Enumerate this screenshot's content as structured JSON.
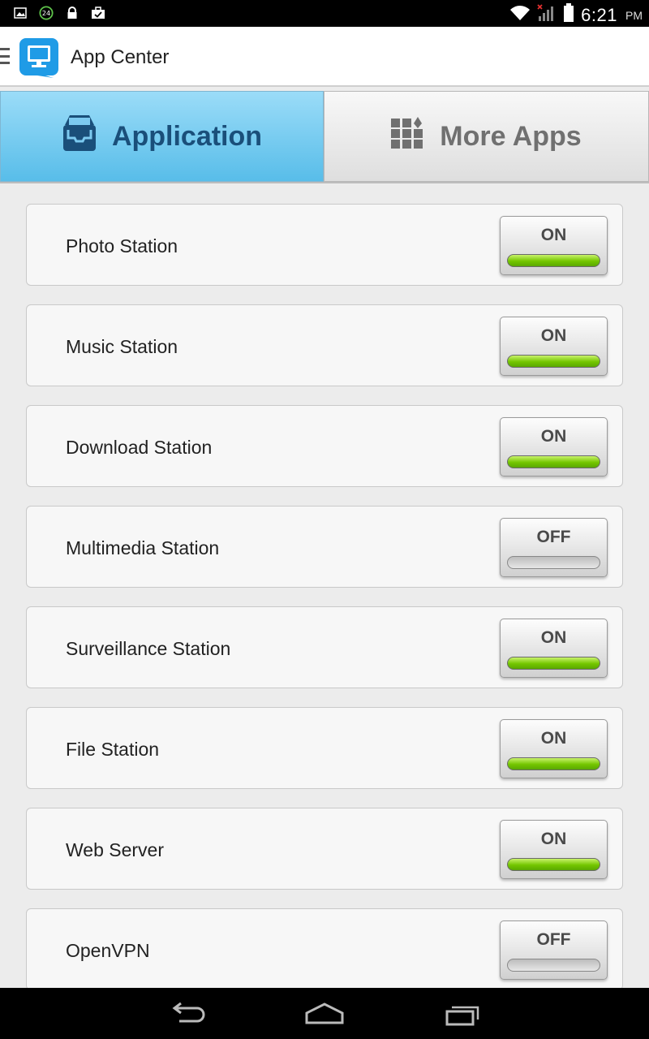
{
  "status_bar": {
    "notification_badge": "24",
    "time": "6:21",
    "ampm": "PM"
  },
  "header": {
    "title": "App Center"
  },
  "tabs": [
    {
      "label": "Application",
      "active": true
    },
    {
      "label": "More Apps",
      "active": false
    }
  ],
  "apps": [
    {
      "name": "Photo Station",
      "state": "ON"
    },
    {
      "name": "Music Station",
      "state": "ON"
    },
    {
      "name": "Download Station",
      "state": "ON"
    },
    {
      "name": "Multimedia Station",
      "state": "OFF"
    },
    {
      "name": "Surveillance Station",
      "state": "ON"
    },
    {
      "name": "File Station",
      "state": "ON"
    },
    {
      "name": "Web Server",
      "state": "ON"
    },
    {
      "name": "OpenVPN",
      "state": "OFF"
    }
  ],
  "colors": {
    "tab_active": "#58bde9",
    "toggle_on": "#73c600",
    "toggle_off": "#bdbdbd"
  },
  "icons": {
    "app_logo": "monitor-chat-icon",
    "application_tab": "inbox-tray-icon",
    "more_apps_tab": "grid-icon",
    "nav": [
      "back-icon",
      "home-icon",
      "recent-apps-icon"
    ]
  }
}
